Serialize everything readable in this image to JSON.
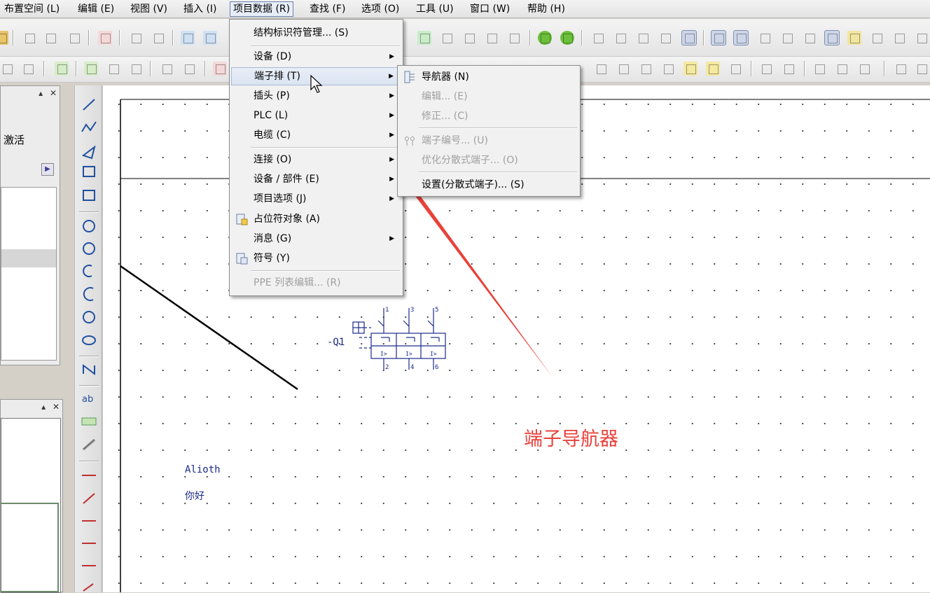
{
  "menubar": {
    "items": [
      {
        "label": "布置空间 (L)"
      },
      {
        "label": "编辑 (E)"
      },
      {
        "label": "视图 (V)"
      },
      {
        "label": "插入 (I)"
      },
      {
        "label": "项目数据 (R)"
      },
      {
        "label": "查找 (F)"
      },
      {
        "label": "选项 (O)"
      },
      {
        "label": "工具 (U)"
      },
      {
        "label": "窗口 (W)"
      },
      {
        "label": "帮助 (H)"
      }
    ]
  },
  "left_panel": {
    "activate_label": "激活",
    "pin_symbol": "▴",
    "close_symbol": "✕"
  },
  "project_menu": {
    "items": [
      {
        "label": "结构标识符管理... (S)"
      },
      {
        "label": "设备 (D)"
      },
      {
        "label": "端子排 (T)"
      },
      {
        "label": "插头 (P)"
      },
      {
        "label": "PLC (L)"
      },
      {
        "label": "电缆 (C)"
      },
      {
        "label": "连接 (O)"
      },
      {
        "label": "设备 / 部件 (E)"
      },
      {
        "label": "项目选项 (J)"
      },
      {
        "label": "占位符对象 (A)"
      },
      {
        "label": "消息 (G)"
      },
      {
        "label": "符号 (Y)"
      },
      {
        "label": "PPE 列表编辑... (R)"
      }
    ],
    "submenu_arrow": "▶"
  },
  "terminal_submenu": {
    "items": [
      {
        "label": "导航器 (N)"
      },
      {
        "label": "编辑... (E)"
      },
      {
        "label": "修正... (C)"
      },
      {
        "label": "端子编号... (U)"
      },
      {
        "label": "优化分散式端子... (O)"
      },
      {
        "label": "设置(分散式端子)... (S)"
      }
    ]
  },
  "canvas": {
    "device_tag": "-Q1",
    "pin_labels_top": [
      "1",
      "3",
      "5"
    ],
    "pin_labels_bottom": [
      "2",
      "4",
      "6"
    ],
    "text_1": "Alioth",
    "text_2": "你好"
  },
  "annotation": {
    "text": "端子导航器",
    "color": "#e8413a"
  }
}
